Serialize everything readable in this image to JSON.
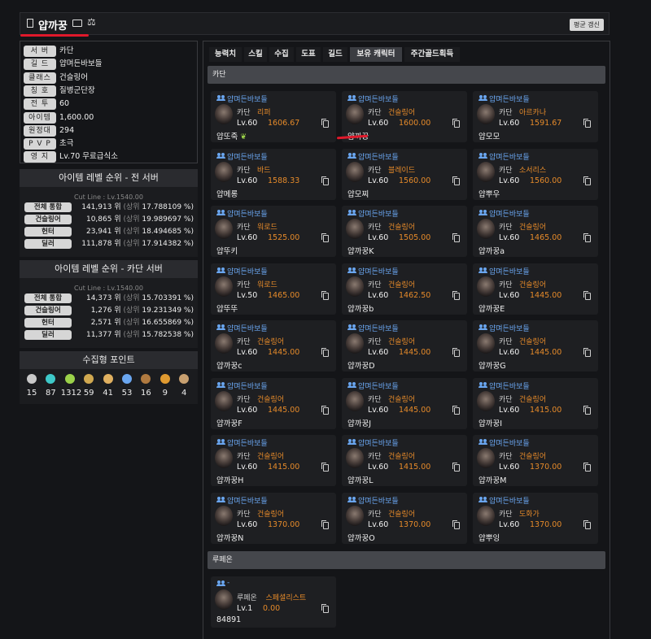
{
  "header": {
    "name": "얍까꿍",
    "scale_glyph": "⚖",
    "refresh_label": "평균 갱신"
  },
  "info": [
    {
      "k": "서 버",
      "v": "카단"
    },
    {
      "k": "길 드",
      "v": "얍며든바보들"
    },
    {
      "k": "클래스",
      "v": "건슬링어"
    },
    {
      "k": "칭 호",
      "v": "질병군단장"
    },
    {
      "k": "전 투",
      "v": "60"
    },
    {
      "k": "아이템",
      "v": "1,600.00"
    },
    {
      "k": "원정대",
      "v": "294"
    },
    {
      "k": "P V P",
      "v": "초극"
    },
    {
      "k": "영 지",
      "v": "Lv.70 무료급식소"
    }
  ],
  "rank_all": {
    "title": "아이템 레벨 순위 - 전 서버",
    "cutline": "Cut Line : Lv.1540.00",
    "rows": [
      {
        "k": "전체 통합",
        "rank": "141,913 위",
        "pre": "(상위",
        "pct": "17.788109 %)"
      },
      {
        "k": "건슬링어",
        "rank": "10,865 위",
        "pre": "(상위",
        "pct": "19.989697 %)"
      },
      {
        "k": "헌터",
        "rank": "23,941 위",
        "pre": "(상위",
        "pct": "18.494685 %)"
      },
      {
        "k": "딜러",
        "rank": "111,878 위",
        "pre": "(상위",
        "pct": "17.914382 %)"
      }
    ]
  },
  "rank_server": {
    "title": "아이템 레벨 순위 - 카단 서버",
    "cutline": "Cut Line : Lv.1540.00",
    "rows": [
      {
        "k": "전체 통합",
        "rank": "14,373 위",
        "pre": "(상위",
        "pct": "15.703391 %)"
      },
      {
        "k": "건슬링어",
        "rank": "1,276 위",
        "pre": "(상위",
        "pct": "19.231349 %)"
      },
      {
        "k": "헌터",
        "rank": "2,571 위",
        "pre": "(상위",
        "pct": "16.655869 %)"
      },
      {
        "k": "딜러",
        "rank": "11,377 위",
        "pre": "(상위",
        "pct": "15.782538 %)"
      }
    ]
  },
  "collection": {
    "title": "수집형 포인트",
    "items": [
      {
        "icon": "mokoko-seed-icon",
        "color": "#c9c9c9",
        "value": "15"
      },
      {
        "icon": "island-heart-icon",
        "color": "#3ec9c9",
        "value": "87"
      },
      {
        "icon": "giant-heart-icon",
        "color": "#9bd24a",
        "value": "1312"
      },
      {
        "icon": "artwork-icon",
        "color": "#d0a850",
        "value": "59"
      },
      {
        "icon": "voyage-icon",
        "color": "#e0b060",
        "value": "41"
      },
      {
        "icon": "star-icon",
        "color": "#6aa6f0",
        "value": "53"
      },
      {
        "icon": "ignea-icon",
        "color": "#b07a40",
        "value": "16"
      },
      {
        "icon": "orpheus-star-icon",
        "color": "#e09a30",
        "value": "9"
      },
      {
        "icon": "world-tree-leaf-icon",
        "color": "#c8a070",
        "value": "4"
      }
    ]
  },
  "tabs": [
    "능력치",
    "스킬",
    "수집",
    "도표",
    "길드",
    "보유 캐릭터",
    "주간골드획득"
  ],
  "active_tab": 5,
  "servers": [
    {
      "name": "카단",
      "cards": [
        {
          "guild": "얍며든바보들",
          "server": "카단",
          "class": "리퍼",
          "lv": "Lv.60",
          "il": "1606.67",
          "name": "얍또죽",
          "leaf": true
        },
        {
          "guild": "얍며든바보들",
          "server": "카단",
          "class": "건슬링어",
          "lv": "Lv.60",
          "il": "1600.00",
          "name": "얍까꿍"
        },
        {
          "guild": "얍며든바보들",
          "server": "카단",
          "class": "아르카나",
          "lv": "Lv.60",
          "il": "1591.67",
          "name": "얍모모"
        },
        {
          "guild": "얍며든바보들",
          "server": "카단",
          "class": "바드",
          "lv": "Lv.60",
          "il": "1588.33",
          "name": "얍메롱"
        },
        {
          "guild": "얍며든바보들",
          "server": "카단",
          "class": "블레이드",
          "lv": "Lv.60",
          "il": "1560.00",
          "name": "얍모찌"
        },
        {
          "guild": "얍며든바보들",
          "server": "카단",
          "class": "소서리스",
          "lv": "Lv.60",
          "il": "1560.00",
          "name": "얍뿌우"
        },
        {
          "guild": "얍며든바보들",
          "server": "카단",
          "class": "워로드",
          "lv": "Lv.60",
          "il": "1525.00",
          "name": "얍뚜키"
        },
        {
          "guild": "얍며든바보들",
          "server": "카단",
          "class": "건슬링어",
          "lv": "Lv.60",
          "il": "1505.00",
          "name": "얍까꿍K"
        },
        {
          "guild": "얍며든바보들",
          "server": "카단",
          "class": "건슬링어",
          "lv": "Lv.60",
          "il": "1465.00",
          "name": "얍까꿍a"
        },
        {
          "guild": "얍며든바보들",
          "server": "카단",
          "class": "워로드",
          "lv": "Lv.50",
          "il": "1465.00",
          "name": "얍뚜뚜"
        },
        {
          "guild": "얍며든바보들",
          "server": "카단",
          "class": "건슬링어",
          "lv": "Lv.60",
          "il": "1462.50",
          "name": "얍까꿍b"
        },
        {
          "guild": "얍며든바보들",
          "server": "카단",
          "class": "건슬링어",
          "lv": "Lv.60",
          "il": "1445.00",
          "name": "얍까꿍E"
        },
        {
          "guild": "얍며든바보들",
          "server": "카단",
          "class": "건슬링어",
          "lv": "Lv.60",
          "il": "1445.00",
          "name": "얍까꿍c"
        },
        {
          "guild": "얍며든바보들",
          "server": "카단",
          "class": "건슬링어",
          "lv": "Lv.60",
          "il": "1445.00",
          "name": "얍까꿍D"
        },
        {
          "guild": "얍며든바보들",
          "server": "카단",
          "class": "건슬링어",
          "lv": "Lv.60",
          "il": "1445.00",
          "name": "얍까꿍G"
        },
        {
          "guild": "얍며든바보들",
          "server": "카단",
          "class": "건슬링어",
          "lv": "Lv.60",
          "il": "1445.00",
          "name": "얍까꿍F"
        },
        {
          "guild": "얍며든바보들",
          "server": "카단",
          "class": "건슬링어",
          "lv": "Lv.60",
          "il": "1445.00",
          "name": "얍까꿍J"
        },
        {
          "guild": "얍며든바보들",
          "server": "카단",
          "class": "건슬링어",
          "lv": "Lv.60",
          "il": "1415.00",
          "name": "얍까꿍I"
        },
        {
          "guild": "얍며든바보들",
          "server": "카단",
          "class": "건슬링어",
          "lv": "Lv.60",
          "il": "1415.00",
          "name": "얍까꿍H"
        },
        {
          "guild": "얍며든바보들",
          "server": "카단",
          "class": "건슬링어",
          "lv": "Lv.60",
          "il": "1415.00",
          "name": "얍까꿍L"
        },
        {
          "guild": "얍며든바보들",
          "server": "카단",
          "class": "건슬링어",
          "lv": "Lv.60",
          "il": "1370.00",
          "name": "얍까꿍M"
        },
        {
          "guild": "얍며든바보들",
          "server": "카단",
          "class": "건슬링어",
          "lv": "Lv.60",
          "il": "1370.00",
          "name": "얍까꿍N"
        },
        {
          "guild": "얍며든바보들",
          "server": "카단",
          "class": "건슬링어",
          "lv": "Lv.60",
          "il": "1370.00",
          "name": "얍까꿍O"
        },
        {
          "guild": "얍며든바보들",
          "server": "카단",
          "class": "도화가",
          "lv": "Lv.60",
          "il": "1370.00",
          "name": "얍뿌잉"
        }
      ]
    },
    {
      "name": "루페온",
      "cards": [
        {
          "guild": "-",
          "server": "루페온",
          "class": "스페셜리스트",
          "lv": "Lv.1",
          "il": "0.00",
          "name": "84891"
        }
      ]
    }
  ]
}
